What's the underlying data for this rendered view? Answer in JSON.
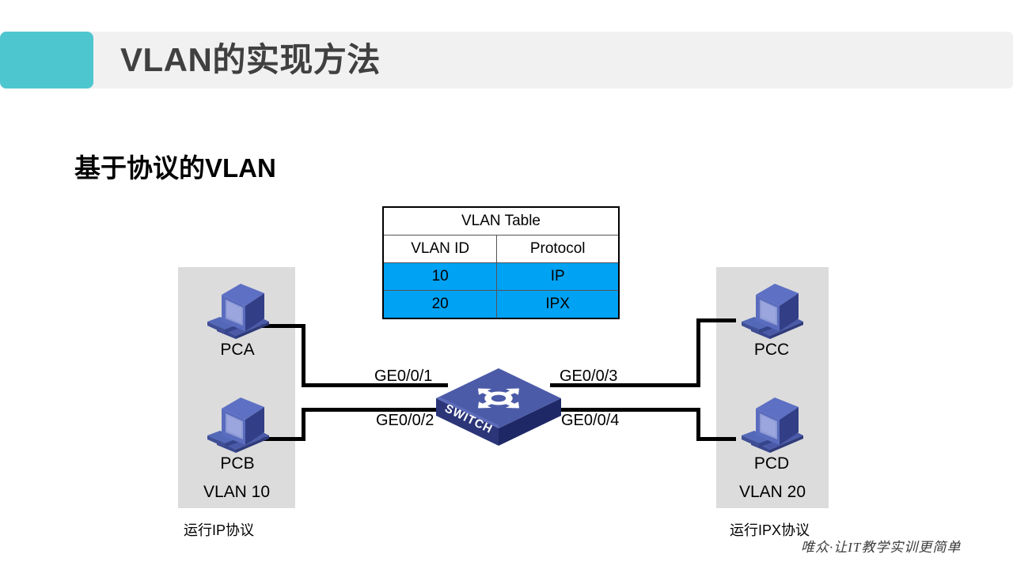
{
  "header": {
    "title": "VLAN的实现方法",
    "accent_color": "#4ec6cf",
    "bar_color": "#f1f1f1"
  },
  "subtitle": "基于协议的VLAN",
  "vlan_table": {
    "title": "VLAN Table",
    "columns": [
      "VLAN ID",
      "Protocol"
    ],
    "rows": [
      {
        "vlan_id": "10",
        "protocol": "IP"
      },
      {
        "vlan_id": "20",
        "protocol": "IPX"
      }
    ],
    "row_highlight_color": "#00a2f3"
  },
  "topology": {
    "switch": {
      "label": "SWITCH",
      "icon": "network-switch-icon"
    },
    "groups": [
      {
        "id": "left",
        "label": "VLAN  10",
        "note": "运行IP协议",
        "hosts": [
          {
            "name": "PCA",
            "port": "GE0/0/1"
          },
          {
            "name": "PCB",
            "port": "GE0/0/2"
          }
        ]
      },
      {
        "id": "right",
        "label": "VLAN  20",
        "note": "运行IPX协议",
        "hosts": [
          {
            "name": "PCC",
            "port": "GE0/0/3"
          },
          {
            "name": "PCD",
            "port": "GE0/0/4"
          }
        ]
      }
    ],
    "ports": [
      "GE0/0/1",
      "GE0/0/2",
      "GE0/0/3",
      "GE0/0/4"
    ]
  },
  "watermark": "唯众·让IT教学实训更简单"
}
